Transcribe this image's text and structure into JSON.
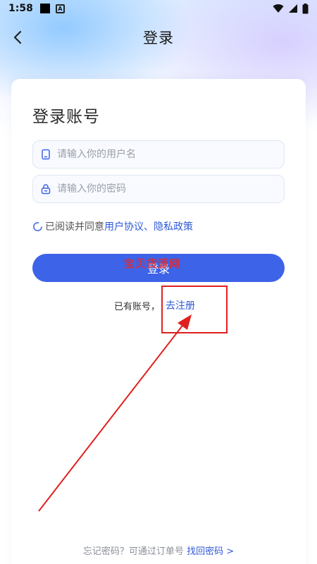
{
  "status_bar": {
    "time": "1:58"
  },
  "header": {
    "title": "登录"
  },
  "card": {
    "title": "登录账号"
  },
  "form": {
    "username_placeholder": "请输入你的用户名",
    "password_placeholder": "请输入你的密码"
  },
  "agreement": {
    "prefix": "已阅读并同意",
    "user_agreement": "用户协议",
    "separator": "、",
    "privacy_policy": "隐私政策"
  },
  "login_button": {
    "label": "登录"
  },
  "watermark": {
    "text": "宝贝货源网"
  },
  "register": {
    "prompt": "已有账号，",
    "link": "去注册"
  },
  "forgot": {
    "prompt": "忘记密码？可通过订单号",
    "link": "找回密码 >"
  },
  "colors": {
    "accent": "#3d63e8",
    "link": "#2f5ad8",
    "annotation": "#e02020"
  },
  "icons": {
    "back": "chevron-left-icon",
    "phone": "phone-icon",
    "lock": "lock-icon",
    "checkbox": "loading-circle-icon"
  }
}
